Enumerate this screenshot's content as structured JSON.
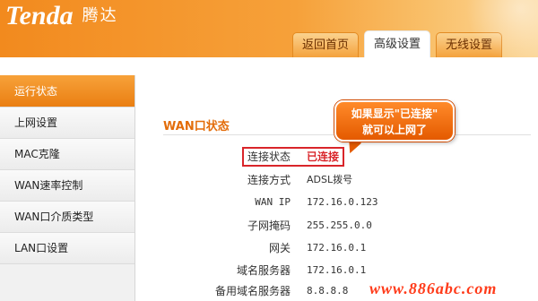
{
  "header": {
    "logo_text": "Tenda",
    "logo_cn": "腾达",
    "tabs": [
      {
        "label": "返回首页"
      },
      {
        "label": "高级设置"
      },
      {
        "label": "无线设置"
      }
    ]
  },
  "sidebar": {
    "items": [
      {
        "label": "运行状态"
      },
      {
        "label": "上网设置"
      },
      {
        "label": "MAC克隆"
      },
      {
        "label": "WAN速率控制"
      },
      {
        "label": "WAN口介质类型"
      },
      {
        "label": "LAN口设置"
      }
    ]
  },
  "main": {
    "section_title": "WAN口状态",
    "rows": [
      {
        "label": "连接状态",
        "value": "已连接"
      },
      {
        "label": "连接方式",
        "value": "ADSL拨号"
      },
      {
        "label": "WAN IP",
        "value": "172.16.0.123"
      },
      {
        "label": "子网掩码",
        "value": "255.255.0.0"
      },
      {
        "label": "网关",
        "value": "172.16.0.1"
      },
      {
        "label": "域名服务器",
        "value": "172.16.0.1"
      },
      {
        "label": "备用域名服务器",
        "value": "8.8.8.8"
      }
    ]
  },
  "callout": {
    "line1": "如果显示\"已连接\"",
    "line2": "就可以上网了"
  },
  "watermark": "www.886abc.com",
  "colors": {
    "accent": "#f28a1e",
    "sidebar_active": "#ea7f12",
    "status_red": "#d9252a",
    "section_title": "#e36c09"
  }
}
